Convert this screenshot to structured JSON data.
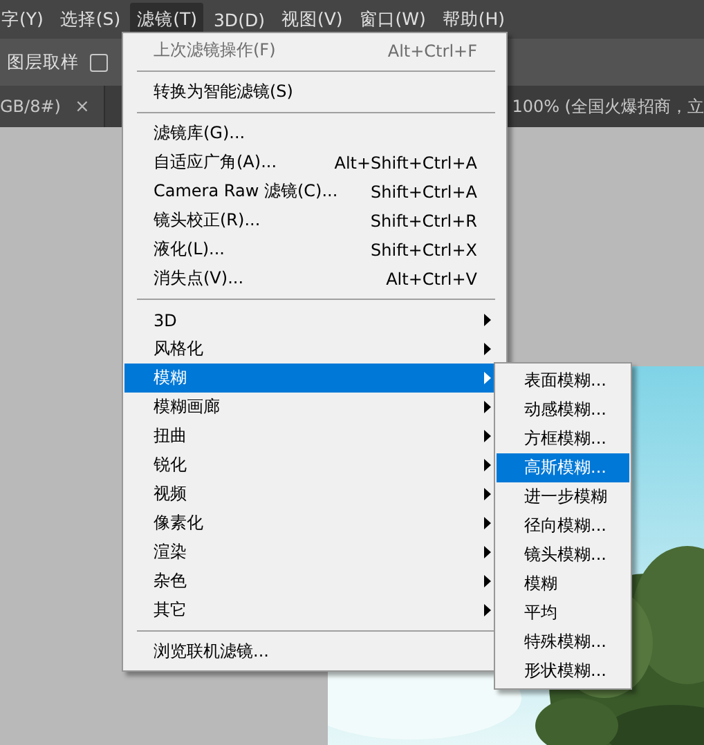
{
  "menu_bar": [
    {
      "label": "字(Y)",
      "selected": false
    },
    {
      "label": "选择(S)",
      "selected": false
    },
    {
      "label": "滤镜(T)",
      "selected": true
    },
    {
      "label": "3D(D)",
      "selected": false
    },
    {
      "label": "视图(V)",
      "selected": false
    },
    {
      "label": "窗口(W)",
      "selected": false
    },
    {
      "label": "帮助(H)",
      "selected": false
    }
  ],
  "options_bar": {
    "sample_label": "图层取样",
    "checkbox": {
      "checked": false
    }
  },
  "document_tabs": [
    {
      "label": "GB/8#)",
      "close": "×"
    },
    {
      "label": "100% (全国火爆招商，立"
    }
  ],
  "filter_menu": {
    "items": [
      {
        "kind": "item",
        "label": "上次滤镜操作(F)",
        "shortcut": "Alt+Ctrl+F",
        "disabled": true
      },
      {
        "kind": "separator"
      },
      {
        "kind": "item",
        "label": "转换为智能滤镜(S)",
        "disabled": false
      },
      {
        "kind": "separator"
      },
      {
        "kind": "item",
        "label": "滤镜库(G)...",
        "disabled": false
      },
      {
        "kind": "item",
        "label": "自适应广角(A)...",
        "shortcut": "Alt+Shift+Ctrl+A",
        "disabled": false
      },
      {
        "kind": "item",
        "label": "Camera Raw 滤镜(C)...",
        "shortcut": "Shift+Ctrl+A",
        "disabled": false
      },
      {
        "kind": "item",
        "label": "镜头校正(R)...",
        "shortcut": "Shift+Ctrl+R",
        "disabled": false
      },
      {
        "kind": "item",
        "label": "液化(L)...",
        "shortcut": "Shift+Ctrl+X",
        "disabled": false
      },
      {
        "kind": "item",
        "label": "消失点(V)...",
        "shortcut": "Alt+Ctrl+V",
        "disabled": false
      },
      {
        "kind": "separator"
      },
      {
        "kind": "submenu",
        "label": "3D",
        "selected": false
      },
      {
        "kind": "submenu",
        "label": "风格化",
        "selected": false
      },
      {
        "kind": "submenu",
        "label": "模糊",
        "selected": true
      },
      {
        "kind": "submenu",
        "label": "模糊画廊",
        "selected": false
      },
      {
        "kind": "submenu",
        "label": "扭曲",
        "selected": false
      },
      {
        "kind": "submenu",
        "label": "锐化",
        "selected": false
      },
      {
        "kind": "submenu",
        "label": "视频",
        "selected": false
      },
      {
        "kind": "submenu",
        "label": "像素化",
        "selected": false
      },
      {
        "kind": "submenu",
        "label": "渲染",
        "selected": false
      },
      {
        "kind": "submenu",
        "label": "杂色",
        "selected": false
      },
      {
        "kind": "submenu",
        "label": "其它",
        "selected": false
      },
      {
        "kind": "separator"
      },
      {
        "kind": "item",
        "label": "浏览联机滤镜...",
        "disabled": false
      }
    ]
  },
  "blur_submenu": {
    "items": [
      {
        "label": "表面模糊...",
        "selected": false
      },
      {
        "label": "动感模糊...",
        "selected": false
      },
      {
        "label": "方框模糊...",
        "selected": false
      },
      {
        "label": "高斯模糊...",
        "selected": true
      },
      {
        "label": "进一步模糊",
        "selected": false
      },
      {
        "label": "径向模糊...",
        "selected": false
      },
      {
        "label": "镜头模糊...",
        "selected": false
      },
      {
        "label": "模糊",
        "selected": false
      },
      {
        "label": "平均",
        "selected": false
      },
      {
        "label": "特殊模糊...",
        "selected": false
      },
      {
        "label": "形状模糊...",
        "selected": false
      }
    ]
  }
}
